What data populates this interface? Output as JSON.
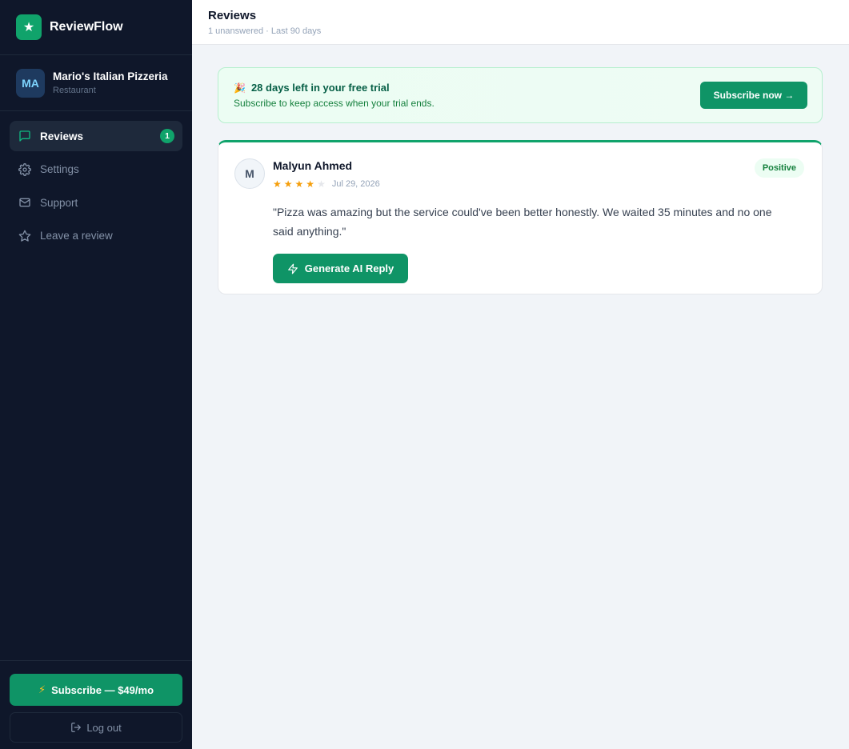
{
  "brand": {
    "name": "ReviewFlow",
    "logo_icon": "star-icon"
  },
  "business": {
    "initials": "MA",
    "name": "Mario's Italian Pizzeria",
    "type": "Restaurant"
  },
  "nav": [
    {
      "label": "Reviews",
      "icon": "chat-bubble-icon",
      "badge": "1",
      "active": true
    },
    {
      "label": "Settings",
      "icon": "gear-icon"
    },
    {
      "label": "Support",
      "icon": "mail-icon"
    },
    {
      "label": "Leave a review",
      "icon": "star-outline-icon"
    }
  ],
  "sidebar_footer": {
    "subscribe_label": "Subscribe — $49/mo",
    "logout_label": "Log out"
  },
  "header": {
    "title": "Reviews",
    "subtitle": "1 unanswered · Last 90 days"
  },
  "trial": {
    "emoji": "🎉",
    "title": "28 days left in your free trial",
    "subtitle": "Subscribe to keep access when your trial ends.",
    "button_label": "Subscribe now →"
  },
  "review": {
    "initial": "M",
    "author": "Malyun Ahmed",
    "rating": 4,
    "max_rating": 5,
    "date": "Jul 29, 2026",
    "sentiment": "Positive",
    "text": "\"Pizza was amazing but the service could've been better honestly. We waited 35 minutes and no one said anything.\"",
    "reply_button_label": "Generate AI Reply"
  },
  "colors": {
    "accent": "#0f9466",
    "sidebar_bg": "#0f172a",
    "star": "#f59e0b"
  }
}
